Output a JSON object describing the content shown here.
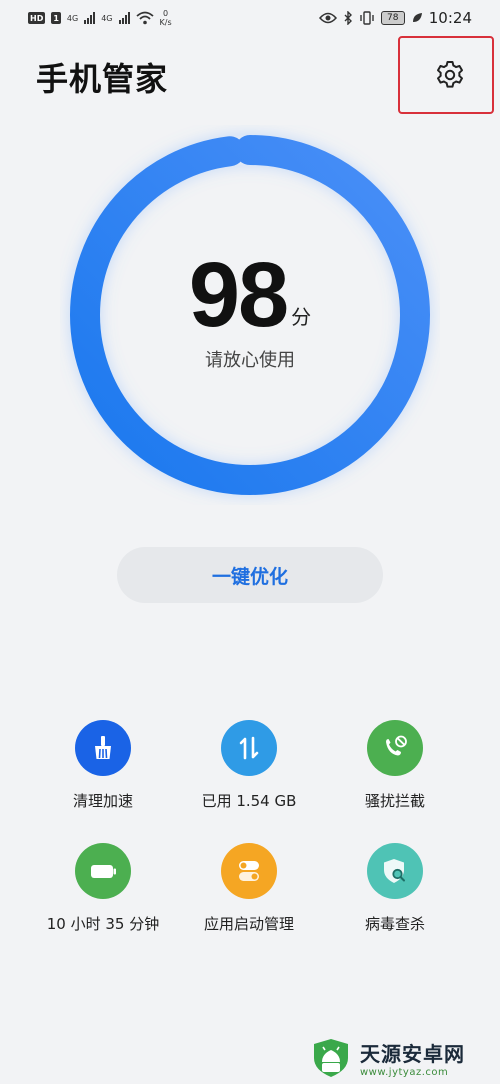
{
  "status_bar": {
    "hd_badge": "HD",
    "sim1": "1",
    "net1": "4G",
    "net2": "4G",
    "speed_value": "0",
    "speed_unit": "K/s",
    "battery": "78",
    "time": "10:24"
  },
  "header": {
    "title": "手机管家",
    "settings_icon": "gear-icon"
  },
  "score": {
    "value": "98",
    "unit": "分",
    "status": "请放心使用",
    "fraction": 0.98,
    "color_start": "#1a78ee",
    "color_end": "#4a8ff7"
  },
  "optimize": {
    "label": "一键优化"
  },
  "tools": [
    {
      "label": "清理加速",
      "icon": "broom-icon",
      "color": "#1a63e6"
    },
    {
      "label": "已用 1.54 GB",
      "icon": "data-transfer-icon",
      "color": "#2f9be6"
    },
    {
      "label": "骚扰拦截",
      "icon": "call-block-icon",
      "color": "#4caf50"
    },
    {
      "label": "10 小时 35 分钟",
      "icon": "battery-icon",
      "color": "#4caf50"
    },
    {
      "label": "应用启动管理",
      "icon": "toggle-icon",
      "color": "#f5a623"
    },
    {
      "label": "病毒查杀",
      "icon": "shield-scan-icon",
      "color": "#4fc3b5"
    }
  ],
  "watermark": {
    "title": "天源安卓网",
    "url": "www.jytyaz.com"
  }
}
